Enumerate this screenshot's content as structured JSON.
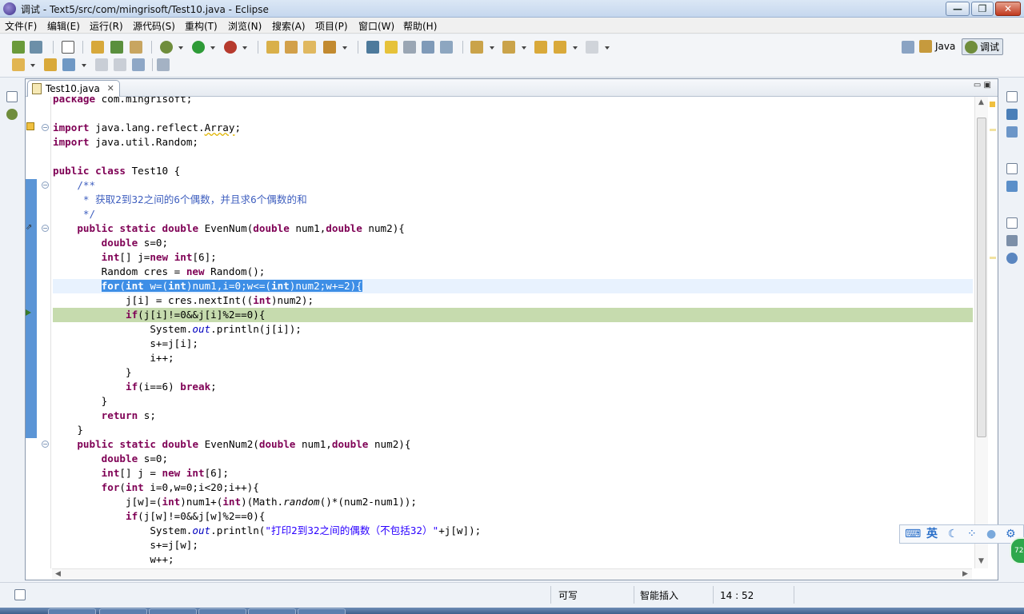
{
  "window": {
    "title": "调试 - Text5/src/com/mingrisoft/Test10.java - Eclipse",
    "min_glyph": "—",
    "max_glyph": "❐",
    "close_glyph": "✕"
  },
  "menu": [
    "文件(F)",
    "编辑(E)",
    "运行(R)",
    "源代码(S)",
    "重构(T)",
    "浏览(N)",
    "搜索(A)",
    "项目(P)",
    "窗口(W)",
    "帮助(H)"
  ],
  "perspectives": {
    "java_label": "Java",
    "debug_label": "调试"
  },
  "editor": {
    "tab_label": "Test10.java",
    "tab_close": "✕",
    "min_max": "▭ ▣",
    "lines": [
      "package com.mingrisoft;",
      "",
      "import java.lang.reflect.Array;",
      "import java.util.Random;",
      "",
      "public class Test10 {",
      "    /**",
      "     * 获取2到32之间的6个偶数，并且求6个偶数的和",
      "     */",
      "    public static double EvenNum(double num1,double num2){",
      "        double s=0;",
      "        int[] j=new int[6];",
      "        Random cres = new Random();",
      "        for(int w=(int)num1,i=0;w<=(int)num2;w+=2){",
      "            j[i] = cres.nextInt((int)num2);",
      "            if(j[i]!=0&&j[i]%2==0){",
      "                System.out.println(j[i]);",
      "                s+=j[i];",
      "                i++;",
      "            }",
      "            if(i==6) break;",
      "        }",
      "        return s;",
      "    }",
      "    public static double EvenNum2(double num1,double num2){",
      "        double s=0;",
      "        int[] j = new int[6];",
      "        for(int i=0,w=0;i<20;i++){",
      "            j[w]=(int)num1+(int)(Math.random()*(num2-num1));",
      "            if(j[w]!=0&&j[w]%2==0){",
      "                System.out.println(\"打印2到32之间的偶数（不包括32）\"+j[w]);",
      "                s+=j[w];",
      "                w++;"
    ]
  },
  "status": {
    "writable": "可写",
    "insert_mode": "智能插入",
    "position": "14 : 52"
  },
  "ime": {
    "lang": "英",
    "moon": "☾",
    "dots": "⁘",
    "user": "●",
    "gear": "⚙",
    "kb": "⌨"
  },
  "badge": "72",
  "colors": {
    "selection": "#3d8ee6",
    "debug_line": "#c6dbae",
    "keyword": "#7f0055",
    "comment": "#3f5fbf",
    "string": "#2a00ff"
  }
}
